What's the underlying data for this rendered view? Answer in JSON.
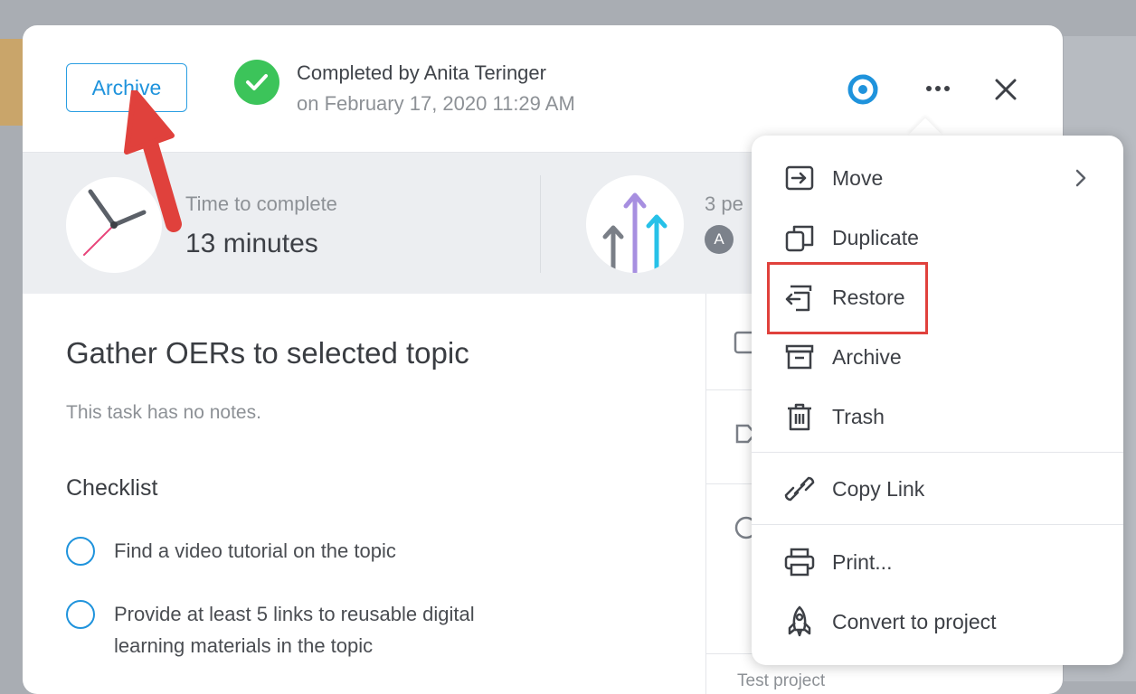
{
  "header": {
    "archive_button": "Archive",
    "completed_by": "Completed by Anita Teringer",
    "completed_on": "on February 17, 2020 11:29 AM"
  },
  "stats": {
    "time_label": "Time to complete",
    "time_value": "13 minutes",
    "people_label": "3 pe",
    "avatar_initial": "A"
  },
  "task": {
    "title": "Gather OERs to selected topic",
    "notes": "This task has no notes.",
    "checklist_heading": "Checklist",
    "checklist_items": [
      "Find a video tutorial on the topic",
      "Provide at least 5 links to reusable digital learning materials in the topic"
    ]
  },
  "right_column": {
    "project_label": "Test project"
  },
  "menu": {
    "items": [
      {
        "label": "Move",
        "icon": "move-icon"
      },
      {
        "label": "Duplicate",
        "icon": "duplicate-icon"
      },
      {
        "label": "Restore",
        "icon": "restore-icon"
      },
      {
        "label": "Archive",
        "icon": "archive-icon"
      },
      {
        "label": "Trash",
        "icon": "trash-icon"
      },
      {
        "label": "Copy Link",
        "icon": "link-icon"
      },
      {
        "label": "Print...",
        "icon": "printer-icon"
      },
      {
        "label": "Convert to project",
        "icon": "rocket-icon"
      }
    ]
  },
  "colors": {
    "accent_blue": "#1f93dc",
    "success_green": "#3cc45a",
    "highlight_red": "#e0413c"
  }
}
